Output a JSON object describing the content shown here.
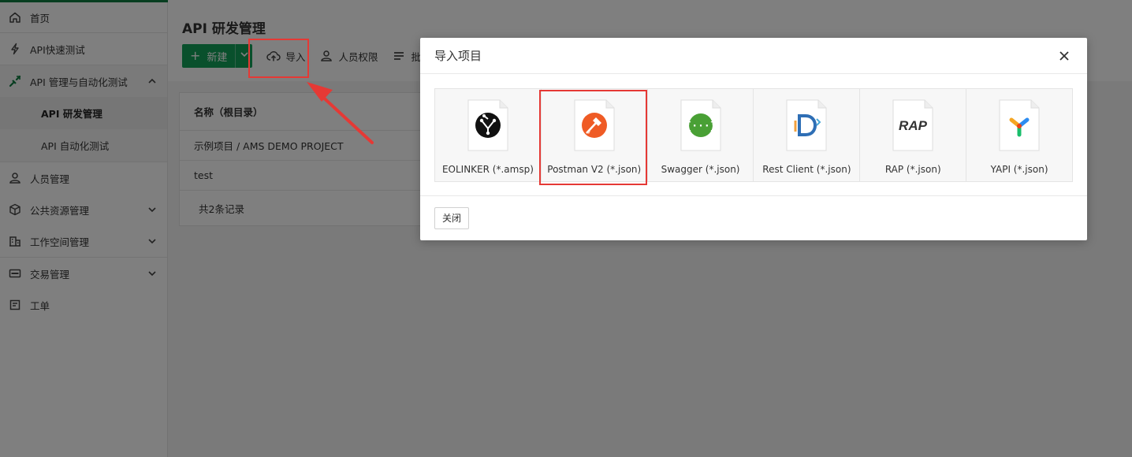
{
  "sidebar": {
    "items": [
      {
        "label": "首页",
        "icon": "home-icon"
      },
      {
        "label": "API快速测试",
        "icon": "bolt-icon"
      },
      {
        "label": "API 管理与自动化测试",
        "icon": "api-link-icon",
        "expanded": true,
        "children": [
          {
            "label": "API 研发管理",
            "active": true
          },
          {
            "label": "API 自动化测试",
            "active": false
          }
        ]
      },
      {
        "label": "人员管理",
        "icon": "user-icon"
      },
      {
        "label": "公共资源管理",
        "icon": "box-icon",
        "collapsible": true
      },
      {
        "label": "工作空间管理",
        "icon": "building-icon",
        "collapsible": true
      },
      {
        "label": "交易管理",
        "icon": "card-icon",
        "collapsible": true
      },
      {
        "label": "工单",
        "icon": "ticket-icon"
      }
    ]
  },
  "main": {
    "title": "API 研发管理",
    "toolbar": {
      "new_label": "新建",
      "import_label": "导入",
      "permissions_label": "人员权限",
      "batch_label": "批量"
    },
    "table": {
      "header": "名称（根目录）",
      "rows": [
        "示例项目 / AMS DEMO PROJECT",
        "test"
      ],
      "footer": "共2条记录"
    }
  },
  "modal": {
    "title": "导入项目",
    "formats": [
      {
        "label": "EOLINKER (*.amsp)",
        "icon": "eolinker-icon"
      },
      {
        "label": "Postman V2 (*.json)",
        "icon": "postman-icon"
      },
      {
        "label": "Swagger (*.json)",
        "icon": "swagger-icon"
      },
      {
        "label": "Rest Client (*.json)",
        "icon": "rest-client-icon"
      },
      {
        "label": "RAP (*.json)",
        "icon": "rap-icon",
        "logo_text": "RAP"
      },
      {
        "label": "YAPI (*.json)",
        "icon": "yapi-icon"
      }
    ],
    "close_button": "关闭"
  },
  "colors": {
    "brand_green": "#13a058",
    "highlight_red": "#e53935",
    "postman_orange": "#ef5b25",
    "swagger_green": "#49a035"
  }
}
